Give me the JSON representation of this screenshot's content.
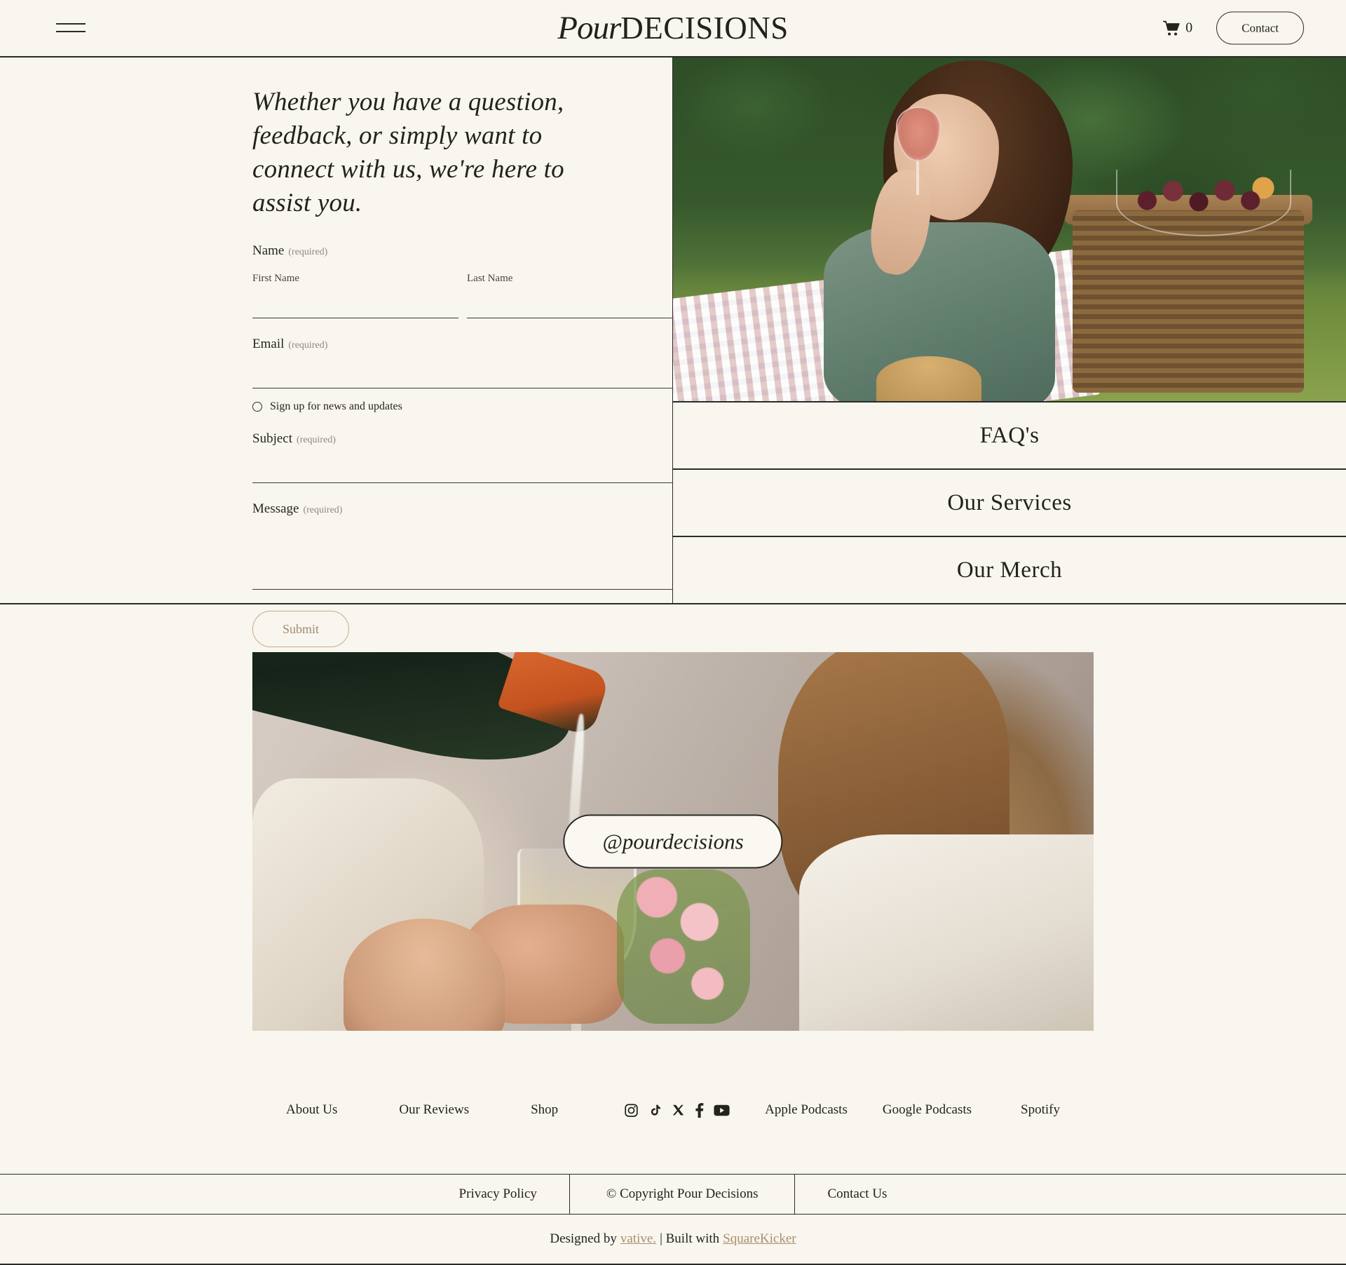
{
  "theme": {
    "background": "#f9f6ef",
    "ink": "#22221f",
    "rule": "#2a2a28",
    "accent_tan": "#a98f6e",
    "submit_border": "#c2ac90",
    "submit_text": "#9d8a72"
  },
  "header": {
    "menu_icon": "hamburger-icon",
    "brand": {
      "script": "Pour",
      "serif": "DECISIONS"
    },
    "cart": {
      "icon": "shopping-cart-icon",
      "count": "0"
    },
    "contact_button": "Contact"
  },
  "contact": {
    "headline": "Whether you have a question, feedback, or simply want to connect with us, we're here to assist you.",
    "fields": {
      "name": {
        "label": "Name",
        "required_note": "(required)",
        "first": {
          "sub_label": "First Name",
          "value": "",
          "placeholder": ""
        },
        "last": {
          "sub_label": "Last Name",
          "value": "",
          "placeholder": ""
        }
      },
      "email": {
        "label": "Email",
        "required_note": "(required)",
        "value": "",
        "placeholder": ""
      },
      "newsletter": {
        "label": "Sign up for news and updates",
        "checked": false
      },
      "subject": {
        "label": "Subject",
        "required_note": "(required)",
        "value": "",
        "placeholder": ""
      },
      "message": {
        "label": "Message",
        "required_note": "(required)",
        "value": "",
        "placeholder": ""
      }
    },
    "submit_label": "Submit"
  },
  "quick_links": [
    {
      "label": "FAQ's"
    },
    {
      "label": "Our Services"
    },
    {
      "label": "Our Merch"
    }
  ],
  "social_feature": {
    "handle": "@pourdecisions",
    "image_alt": "pouring-wine-picnic-photo"
  },
  "footer_nav": {
    "left_links": [
      {
        "label": "About Us"
      },
      {
        "label": "Our Reviews"
      },
      {
        "label": "Shop"
      }
    ],
    "social_icons": [
      {
        "name": "instagram-icon"
      },
      {
        "name": "tiktok-icon"
      },
      {
        "name": "x-twitter-icon"
      },
      {
        "name": "facebook-icon"
      },
      {
        "name": "youtube-icon"
      }
    ],
    "right_links": [
      {
        "label": "Apple Podcasts"
      },
      {
        "label": "Google Podcasts"
      },
      {
        "label": "Spotify"
      }
    ]
  },
  "legal": {
    "privacy": "Privacy Policy",
    "copyright": "© Copyright Pour Decisions",
    "contact": "Contact Us"
  },
  "credit": {
    "prefix": "Designed by",
    "designer": "vative.",
    "separator": "| Built with",
    "builder": "SquareKicker"
  }
}
